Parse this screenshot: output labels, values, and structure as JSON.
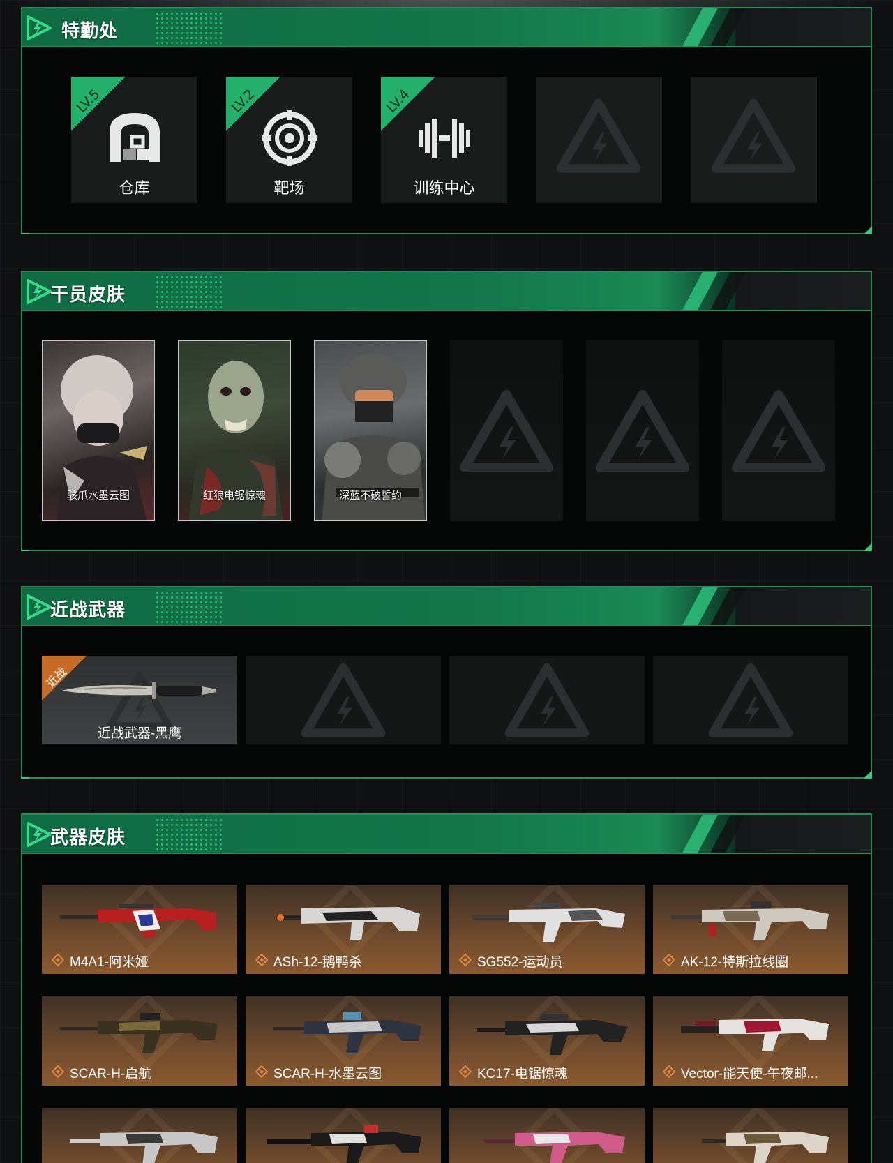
{
  "sections": {
    "facilities": {
      "title": "特勤处",
      "items": [
        {
          "label": "仓库",
          "level": "LV.5",
          "icon": "warehouse-icon"
        },
        {
          "label": "靶场",
          "level": "LV.2",
          "icon": "target-icon"
        },
        {
          "label": "训练中心",
          "level": "LV.4",
          "icon": "dumbbell-icon"
        }
      ]
    },
    "agent_skins": {
      "title": "干员皮肤",
      "items": [
        {
          "label": "骇爪水墨云图"
        },
        {
          "label": "红狼电锯惊魂"
        },
        {
          "label": "深蓝不破誓约"
        }
      ]
    },
    "melee": {
      "title": "近战武器",
      "items": [
        {
          "label": "近战武器-黑鹰",
          "tag": "近战"
        }
      ]
    },
    "weapon_skins": {
      "title": "武器皮肤",
      "items": [
        {
          "label": "M4A1-阿米娅"
        },
        {
          "label": "ASh-12-鹅鸭杀"
        },
        {
          "label": "SG552-运动员"
        },
        {
          "label": "AK-12-特斯拉线圈"
        },
        {
          "label": "SCAR-H-启航"
        },
        {
          "label": "SCAR-H-水墨云图"
        },
        {
          "label": "KC17-电锯惊魂"
        },
        {
          "label": "Vector-能天使-午夜邮..."
        }
      ]
    }
  },
  "colors": {
    "accent": "#23b06a",
    "header_green": "#13774b",
    "melee_tag": "#c86b27",
    "weapon_card": "#704b2c"
  }
}
